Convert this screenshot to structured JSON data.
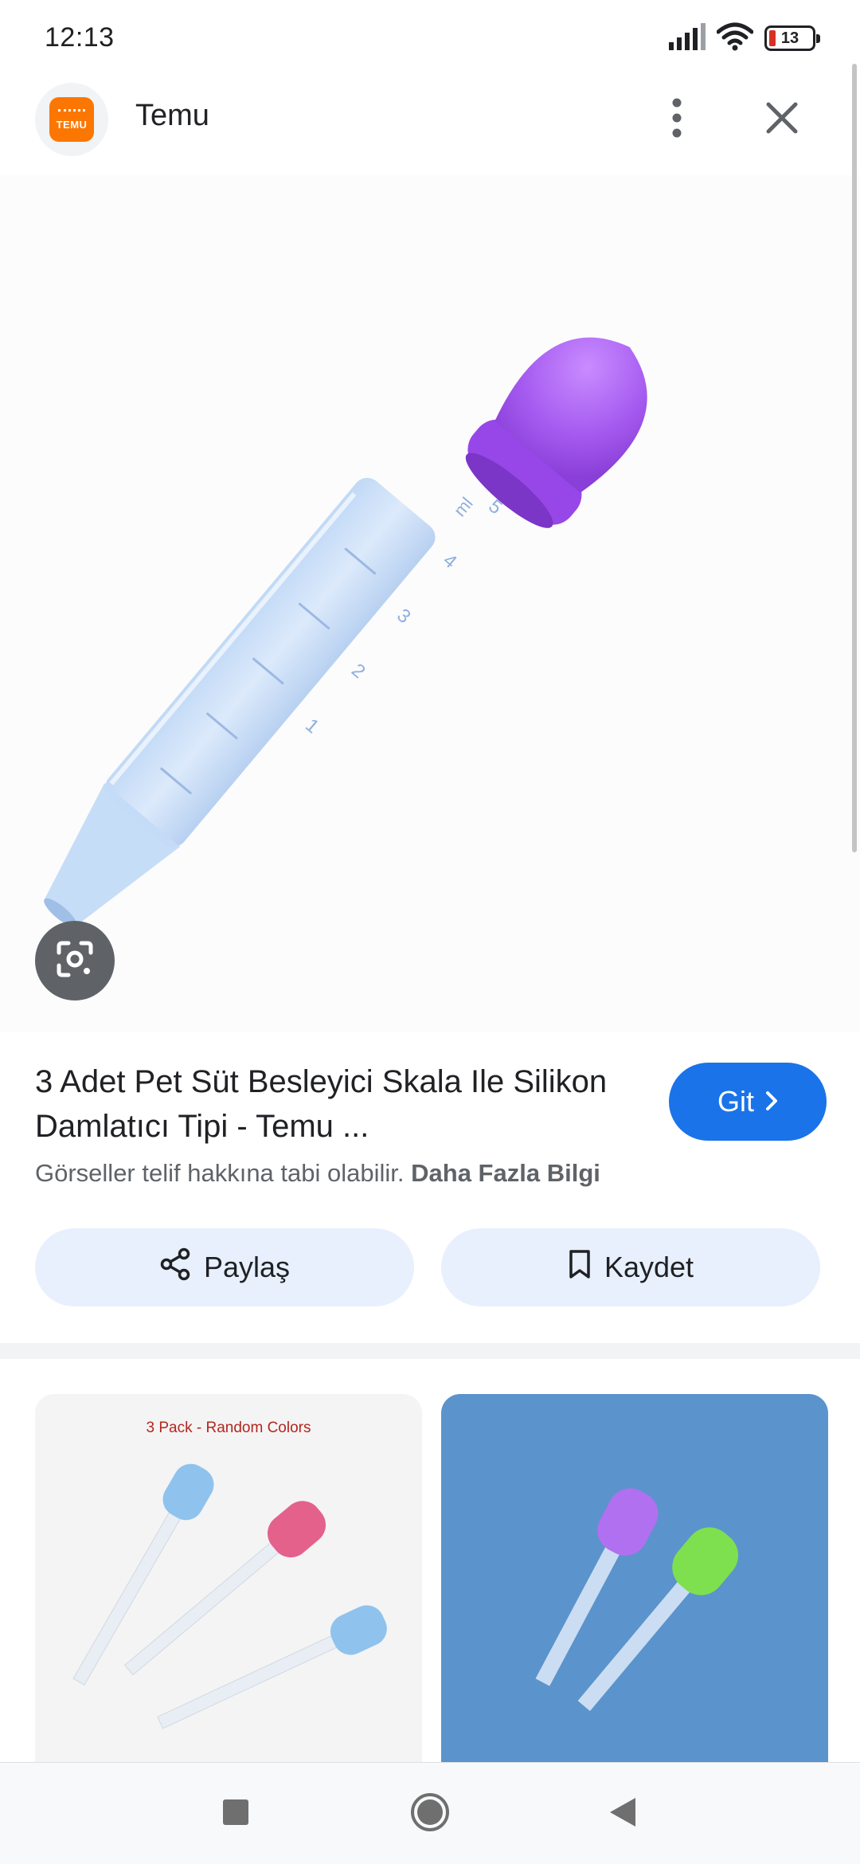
{
  "status_bar": {
    "time": "12:13",
    "battery": "13"
  },
  "header": {
    "title": "Temu",
    "logo_text": "TEMU"
  },
  "main_image": {
    "scale_marks": [
      "1",
      "2",
      "3",
      "4",
      "5"
    ],
    "scale_unit": "ml"
  },
  "result": {
    "title": "3 Adet Pet Süt Besleyici Skala Ile Silikon Damlatıcı Tipi - Temu ...",
    "go_label": "Git",
    "copyright_text": "Görseller telif hakkına tabi olabilir.",
    "more_info_label": "Daha Fazla Bilgi"
  },
  "actions": {
    "share_label": "Paylaş",
    "save_label": "Kaydet"
  },
  "related": {
    "card1_caption": "3 Pack - Random Colors"
  },
  "icons": {
    "signal": "signal-icon",
    "wifi": "wifi-icon",
    "battery": "battery-icon",
    "more": "more-vert-icon",
    "close": "close-icon",
    "lens": "google-lens-icon",
    "go_chevron": "chevron-right-icon",
    "share": "share-icon",
    "save": "bookmark-icon",
    "recents": "square-icon",
    "home": "circle-icon",
    "back": "triangle-back-icon"
  },
  "colors": {
    "accent": "#1a73e8",
    "brand": "#fb7701",
    "bulb_purple": "#a65bf0",
    "action_bg": "#e8f0fe"
  }
}
